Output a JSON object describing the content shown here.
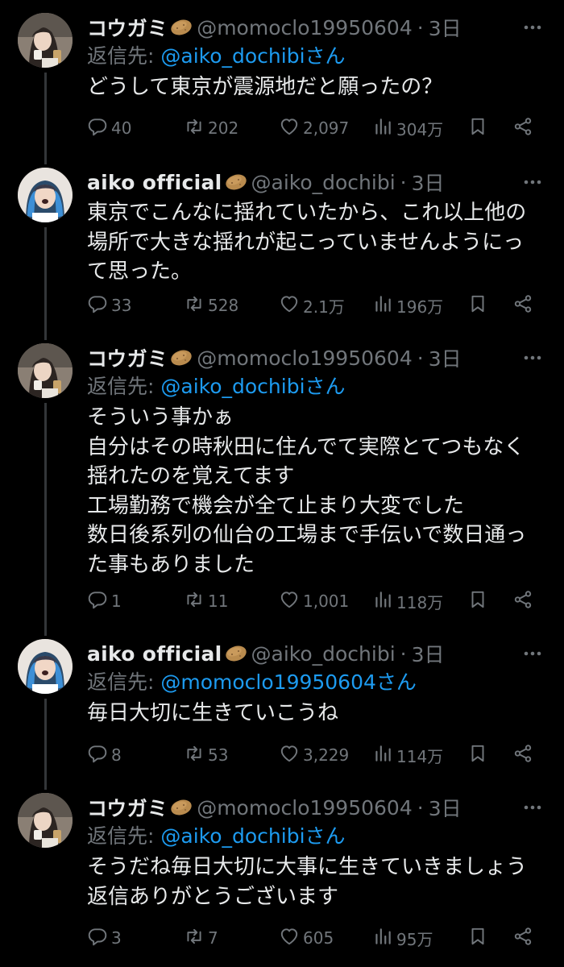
{
  "reply_prefix": "返信先: ",
  "reply_suffix": "さん",
  "tweets": [
    {
      "name": "コウガミ",
      "handle": "@momoclo19950604",
      "time": "3日",
      "reply_to": "@aiko_dochibi",
      "text": "どうして東京が震源地だと願ったの？",
      "replies": "40",
      "retweets": "202",
      "likes": "2,097",
      "views": "304万"
    },
    {
      "name": "aiko official",
      "handle": "@aiko_dochibi",
      "time": "3日",
      "reply_to": null,
      "text": "東京でこんなに揺れていたから、これ以上他の\n場所で大きな揺れが起こっていませんようにっ\nて思った。",
      "replies": "33",
      "retweets": "528",
      "likes": "2.1万",
      "views": "196万"
    },
    {
      "name": "コウガミ",
      "handle": "@momoclo19950604",
      "time": "3日",
      "reply_to": "@aiko_dochibi",
      "text": "そういう事かぁ\n自分はその時秋田に住んでて実際とてつもなく\n揺れたのを覚えてます\n工場勤務で機会が全て止まり大変でした\n数日後系列の仙台の工場まで手伝いで数日通っ\nた事もありました",
      "replies": "1",
      "retweets": "11",
      "likes": "1,001",
      "views": "118万"
    },
    {
      "name": "aiko official",
      "handle": "@aiko_dochibi",
      "time": "3日",
      "reply_to": "@momoclo19950604",
      "text": "毎日大切に生きていこうね",
      "replies": "8",
      "retweets": "53",
      "likes": "3,229",
      "views": "114万"
    },
    {
      "name": "コウガミ",
      "handle": "@momoclo19950604",
      "time": "3日",
      "reply_to": "@aiko_dochibi",
      "text": "そうだね毎日大切に大事に生きていきましょう\n返信ありがとうございます",
      "replies": "3",
      "retweets": "7",
      "likes": "605",
      "views": "95万"
    }
  ],
  "colors": {
    "background": "#000000",
    "text": "#e7e9ea",
    "muted": "#71767b",
    "link": "#1d9bf0",
    "line": "#333639"
  },
  "icons": {
    "reply": "speech-bubble-icon",
    "retweet": "retweet-arrows-icon",
    "like": "heart-icon",
    "views": "bar-chart-icon",
    "bookmark": "bookmark-icon",
    "share": "share-icon",
    "more": "more-dots-icon",
    "badge": "potato-emoji-icon"
  }
}
